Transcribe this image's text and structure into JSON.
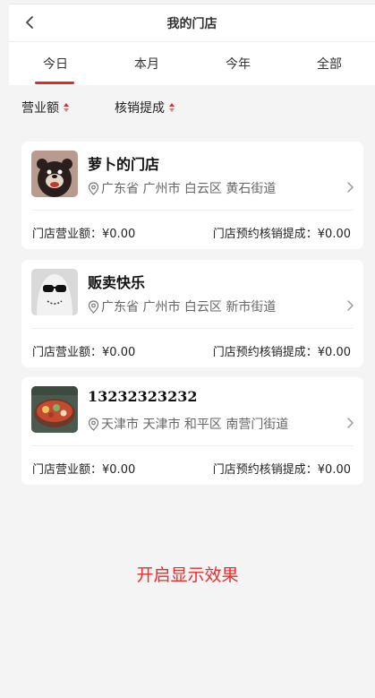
{
  "header": {
    "title": "我的门店",
    "back_icon": "chevron-left-icon"
  },
  "tabs": [
    {
      "label": "今日",
      "active": true
    },
    {
      "label": "本月",
      "active": false
    },
    {
      "label": "今年",
      "active": false
    },
    {
      "label": "全部",
      "active": false
    }
  ],
  "sort": [
    {
      "label": "营业额",
      "icon": "sort-icon"
    },
    {
      "label": "核销提成",
      "icon": "sort-icon"
    }
  ],
  "stores": [
    {
      "name": "萝卜的门店",
      "address": "广东省 广州市 白云区 黄石街道",
      "revenue_label": "门店营业额：",
      "revenue": "¥0.00",
      "commission_label": "门店预约核销提成：",
      "commission": "¥0.00"
    },
    {
      "name": "贩卖快乐",
      "address": "广东省 广州市 白云区 新市街道",
      "revenue_label": "门店营业额：",
      "revenue": "¥0.00",
      "commission_label": "门店预约核销提成：",
      "commission": "¥0.00"
    },
    {
      "name": "13232323232",
      "address": "天津市 天津市 和平区 南营门街道",
      "revenue_label": "门店营业额：",
      "revenue": "¥0.00",
      "commission_label": "门店预约核销提成：",
      "commission": "¥0.00"
    }
  ],
  "footer": {
    "enable_label": "开启显示效果"
  },
  "colors": {
    "accent": "#e02a2a",
    "background": "#f4f4f4"
  }
}
